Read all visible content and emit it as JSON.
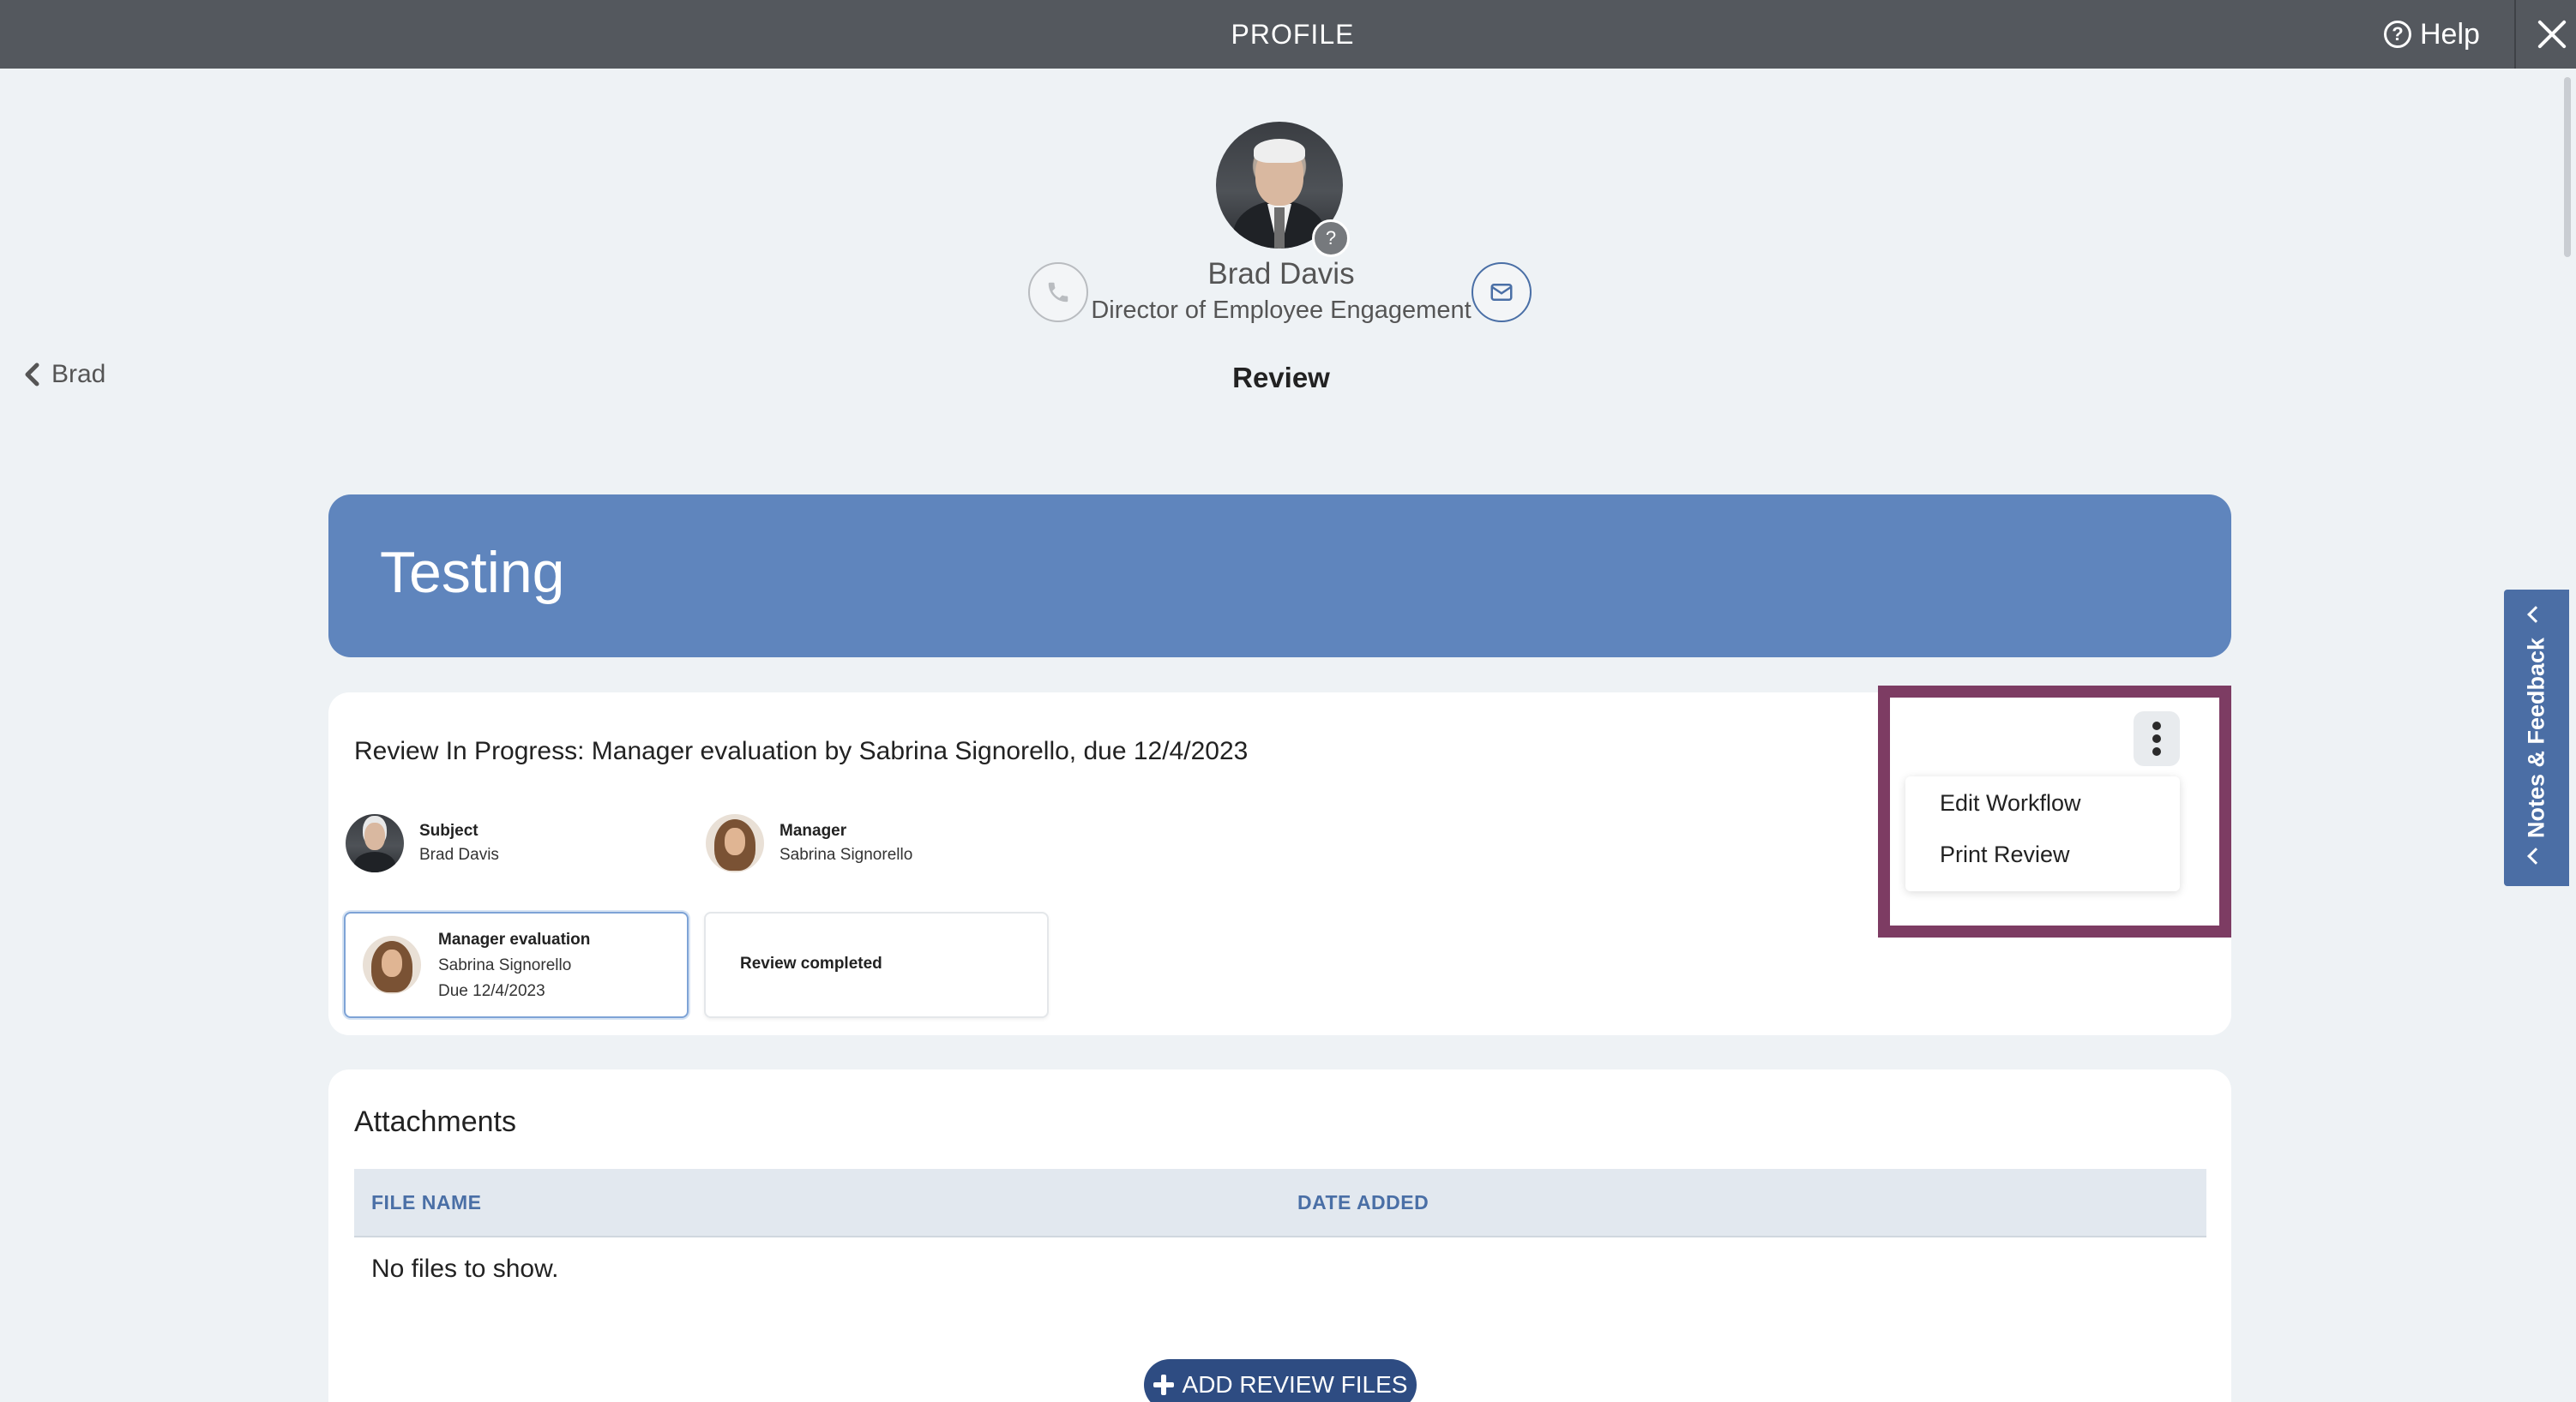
{
  "topbar": {
    "title": "PROFILE",
    "help_label": "Help",
    "help_icon_glyph": "?"
  },
  "profile": {
    "name": "Brad Davis",
    "role": "Director of Employee Engagement",
    "badge_glyph": "?"
  },
  "nav": {
    "back_label": "Brad",
    "section_title": "Review"
  },
  "banner": {
    "title": "Testing",
    "color": "#5f85bd"
  },
  "review": {
    "status": "Review In Progress: Manager evaluation by Sabrina Signorello, due 12/4/2023",
    "participants": [
      {
        "role": "Subject",
        "name": "Brad Davis"
      },
      {
        "role": "Manager",
        "name": "Sabrina Signorello"
      }
    ],
    "steps": [
      {
        "title": "Manager evaluation",
        "person": "Sabrina Signorello",
        "due": "Due 12/4/2023"
      },
      {
        "title": "Review completed"
      }
    ],
    "menu": {
      "items": [
        "Edit Workflow",
        "Print Review"
      ]
    }
  },
  "attachments": {
    "title": "Attachments",
    "columns": [
      "FILE NAME",
      "DATE ADDED"
    ],
    "empty_text": "No files to show.",
    "add_button_label": "ADD REVIEW FILES"
  },
  "side_tab": {
    "label": "Notes & Feedback"
  },
  "colors": {
    "topbar": "#54585e",
    "accent": "#4a6fa6",
    "highlight": "#7d3c63",
    "button": "#2e4c82"
  }
}
